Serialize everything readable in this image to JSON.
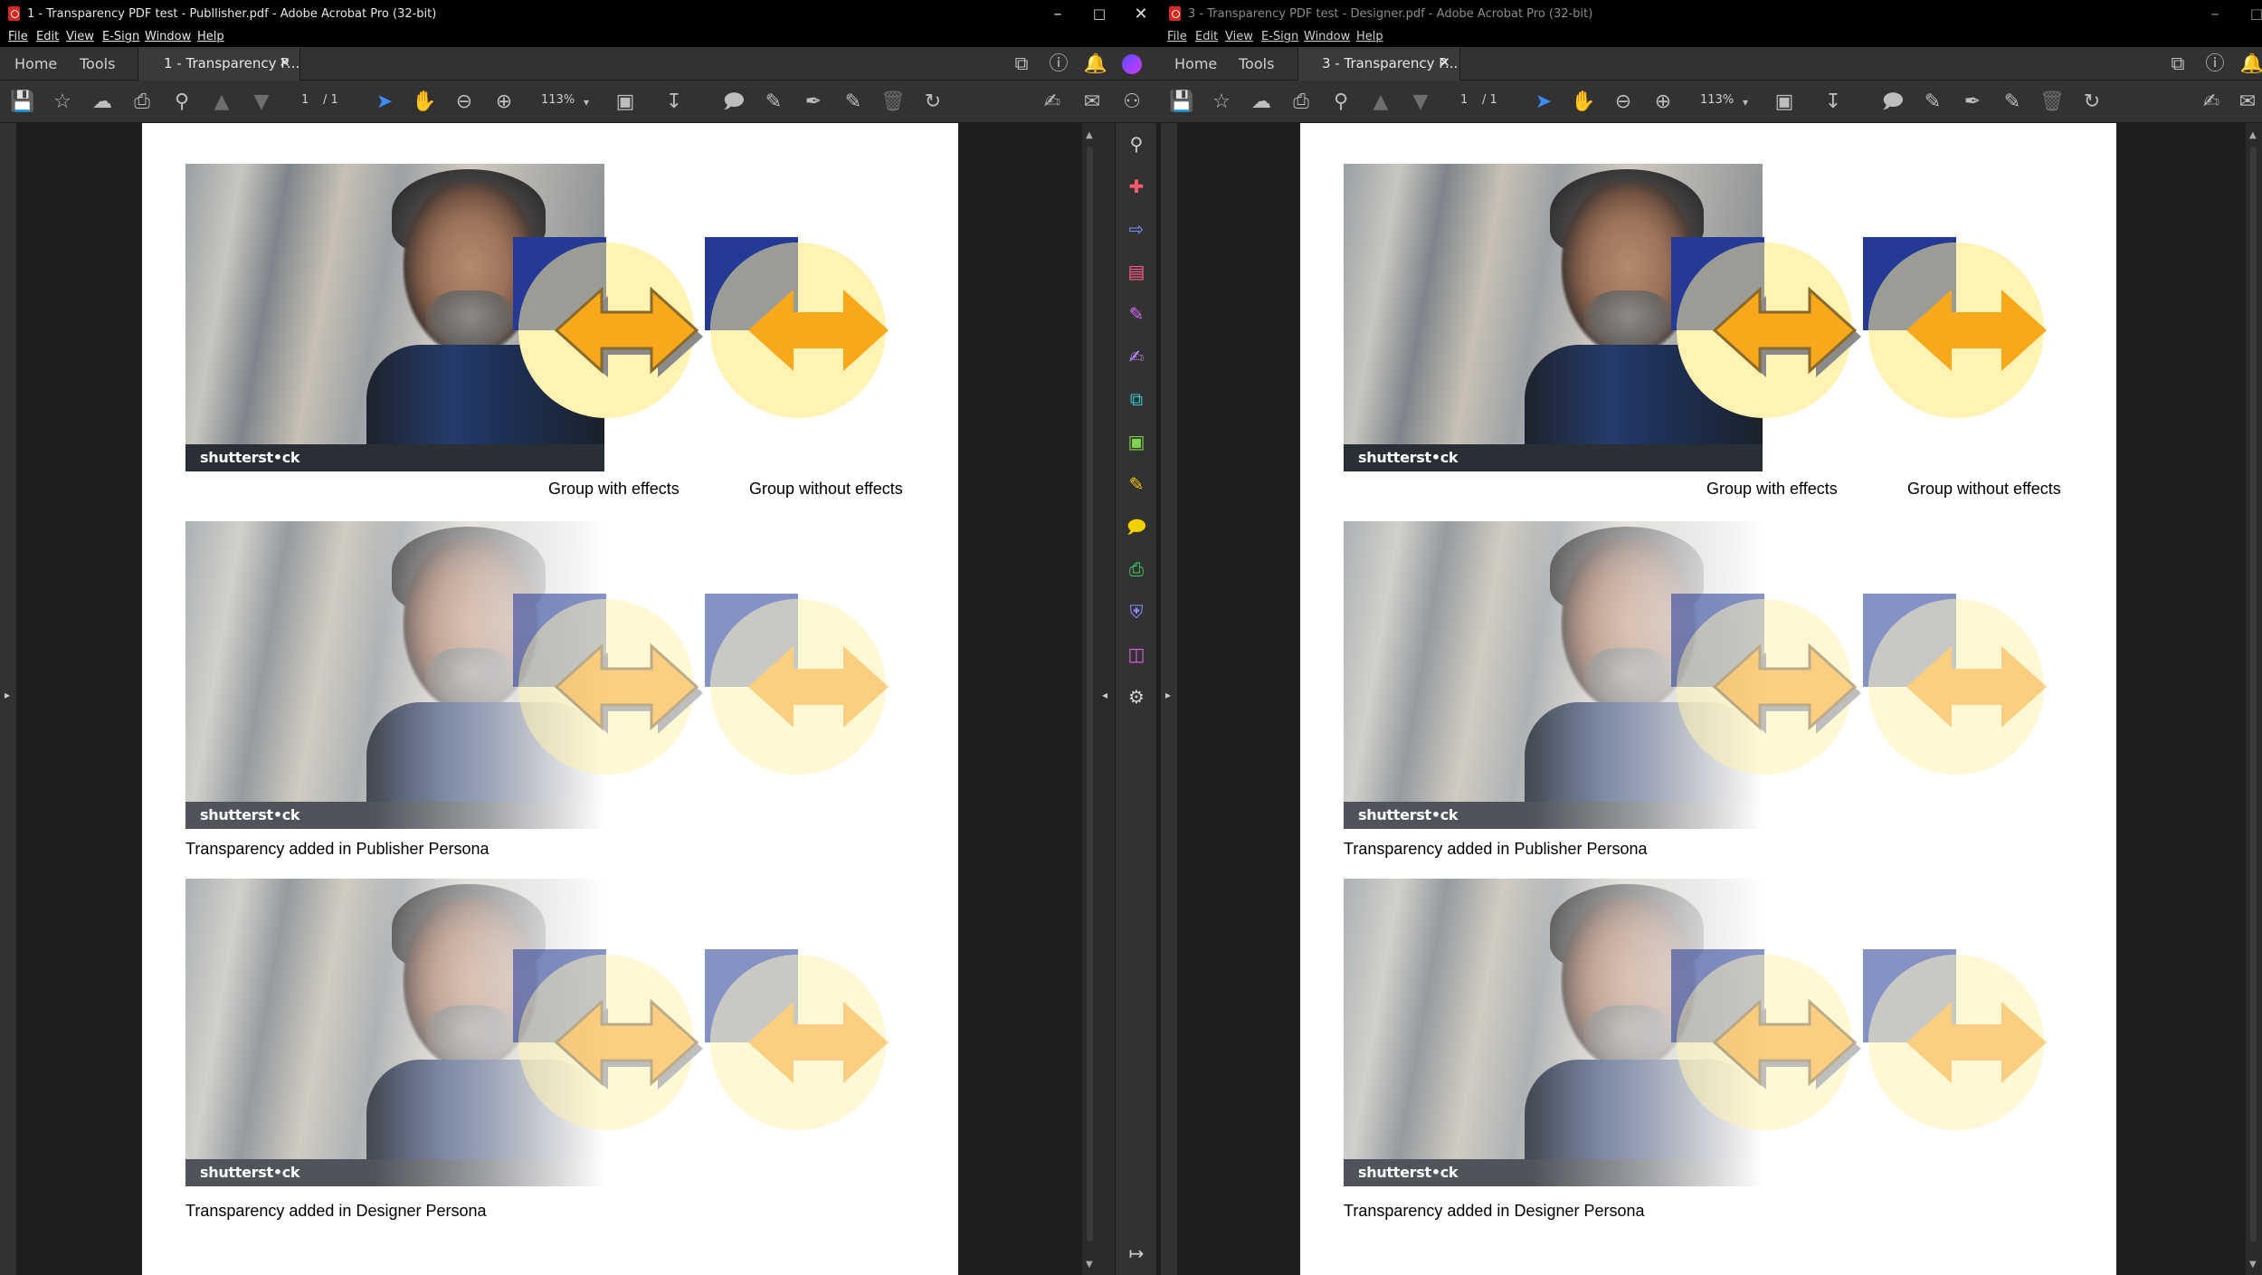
{
  "left_window": {
    "title": "1 - Transparency PDF test - Publlisher.pdf - Adobe Acrobat Pro (32-bit)",
    "menu": [
      "File",
      "Edit",
      "View",
      "E-Sign",
      "Window",
      "Help"
    ],
    "tabs": {
      "home": "Home",
      "tools": "Tools",
      "document": "1 - Transparency P..."
    },
    "page_current": "1",
    "page_total": "/ 1",
    "zoom": "113%"
  },
  "right_window": {
    "title": "3 - Transparency PDF test - Designer.pdf - Adobe Acrobat Pro (32-bit)",
    "menu": [
      "File",
      "Edit",
      "View",
      "E-Sign",
      "Window",
      "Help"
    ],
    "tabs": {
      "home": "Home",
      "tools": "Tools",
      "document": "3 - Transparency P..."
    },
    "page_current": "1",
    "page_total": "/ 1",
    "zoom": "113%"
  },
  "page": {
    "watermark": "shutterst•ck",
    "captions": {
      "group_with_effects": "Group with effects",
      "group_without_effects": "Group without effects",
      "publisher_persona": "Transparency added in Publisher Persona",
      "designer_persona": "Transparency added in Designer Persona"
    }
  },
  "colors": {
    "blue_square": "#243a94",
    "circle": "#fff3b3",
    "arrow": "#f7a81b",
    "acrobat_red": "#d9281f",
    "select_blue": "#3d8bf2"
  },
  "icons": {
    "window_controls": [
      "minimize-icon",
      "maximize-icon",
      "close-icon"
    ],
    "right_rail": [
      "zoom-icon",
      "create-pdf-icon",
      "export-pdf-icon",
      "organize-pages-icon",
      "edit-pdf-icon",
      "fill-sign-icon",
      "combine-files-icon",
      "compress-pdf-icon",
      "request-signature-icon",
      "comment-icon",
      "print-production-icon",
      "protect-icon",
      "scan-ocr-icon",
      "more-tools-icon"
    ]
  }
}
